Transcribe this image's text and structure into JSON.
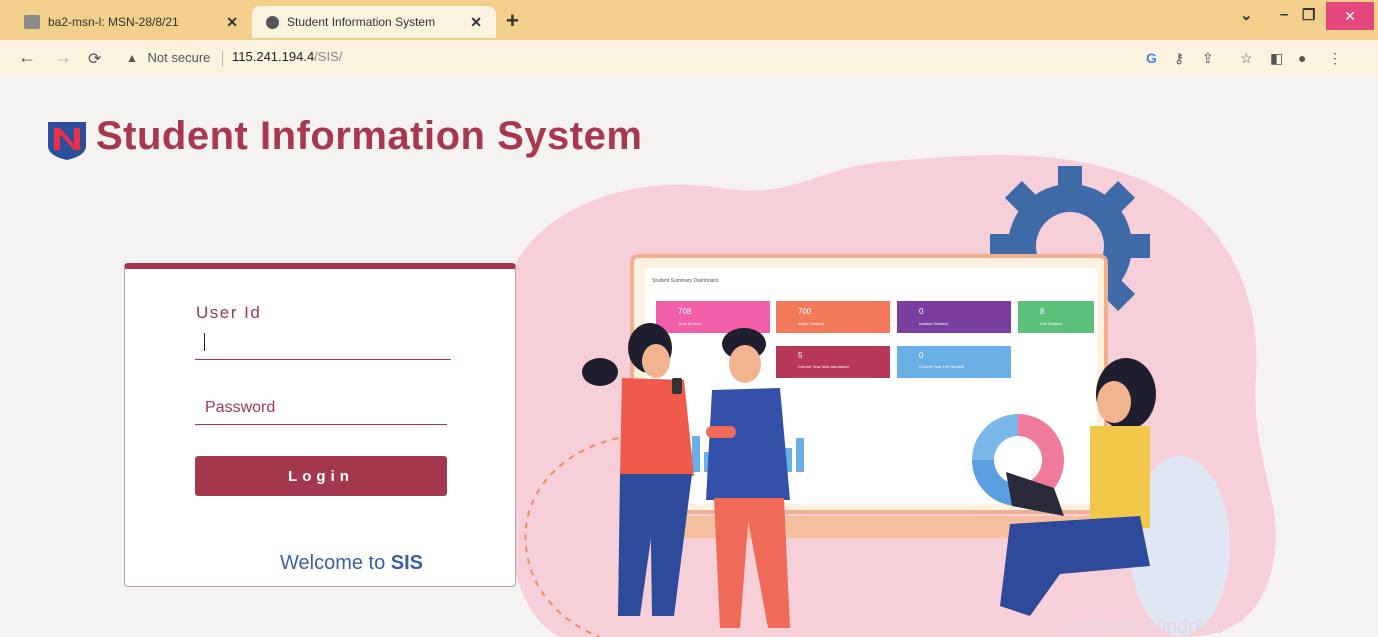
{
  "browser": {
    "tabs": [
      {
        "title": "ba2-msn-l: MSN-28/8/21"
      },
      {
        "title": "Student Information System"
      }
    ],
    "new_tab": "+",
    "address": {
      "security": "Not secure",
      "host": "115.241.194.4",
      "path": "/SIS/"
    },
    "colors": {
      "tabbar": "#f2cf8a",
      "close": "#e4477c"
    }
  },
  "page": {
    "title": "Student Information System",
    "brand_color": "#a3384f"
  },
  "login": {
    "user_label": "User Id",
    "user_value": "",
    "password_placeholder": "Password",
    "login_button": "Login",
    "welcome_prefix": "Welcome to ",
    "welcome_brand": "SIS"
  },
  "dashboard": {
    "title": "Student Summary Dashboard",
    "cards": [
      {
        "value": "708",
        "label": "Total Student",
        "color": "#f25ea8"
      },
      {
        "value": "700",
        "label": "Active Student",
        "color": "#f27a5a"
      },
      {
        "value": "0",
        "label": "Inactive Student",
        "color": "#7a3ea0"
      },
      {
        "value": "8",
        "label": "Left Student",
        "color": "#5cbf7a"
      },
      {
        "value": "5",
        "label": "Current Year New Admission",
        "color": "#b8385a"
      },
      {
        "value": "0",
        "label": "Current Year Left Student",
        "color": "#6aaee6"
      }
    ]
  },
  "watermark": "Activate Windows"
}
